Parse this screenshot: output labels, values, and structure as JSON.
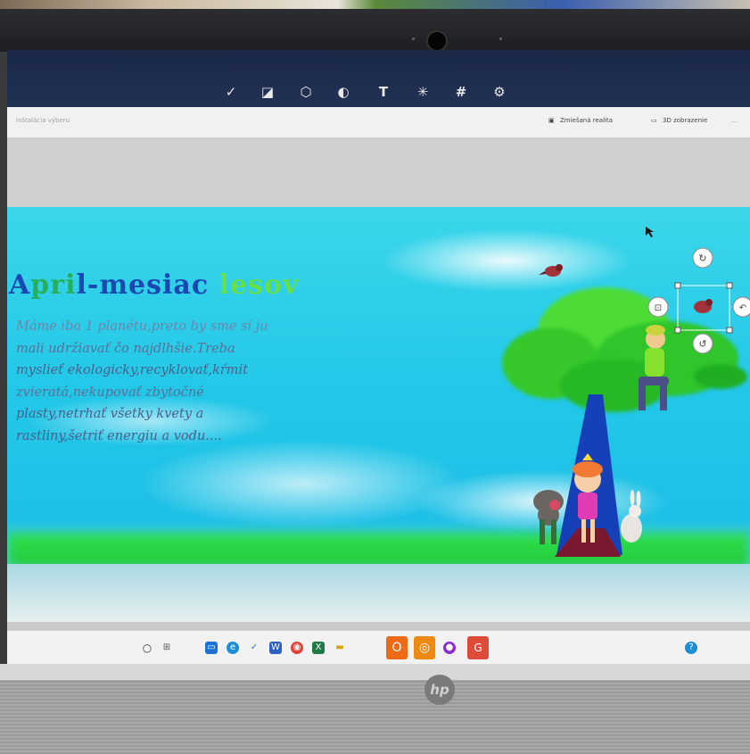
{
  "canvas": {
    "title_parts": [
      "A",
      "pri",
      "l-mesiac ",
      "lesov"
    ],
    "paragraph_lines": [
      "Máme iba 1 planétu,preto by sme si ju",
      "mali udržiavať čo najdlhšie.Treba",
      "myslieť ekologicky,recyklovať,kŕmit",
      "zvieratá,nekupovať zbytočné",
      "plasty,netrhať všetky kvety a",
      "rastliny,šetriť energiu a vodu...."
    ]
  },
  "subbar": {
    "left_label": "Inštalácia výberu",
    "mixed_reality_label": "Zmiešaná realita",
    "view3d_label": "3D zobrazenie",
    "more_label": "..."
  },
  "toolbar": {
    "tools": [
      "brush-icon",
      "2d-shapes-icon",
      "3d-shapes-icon",
      "stickers-icon",
      "text-icon",
      "effects-icon",
      "canvas-icon",
      "3d-library-icon"
    ]
  },
  "monitor": {
    "brand": "hp"
  },
  "colors": {
    "sky": "#22c7e8",
    "grass": "#2ee04a",
    "title_blue": "#1848b0",
    "title_green": "#65e04b",
    "toolbar": "#1b2848"
  }
}
